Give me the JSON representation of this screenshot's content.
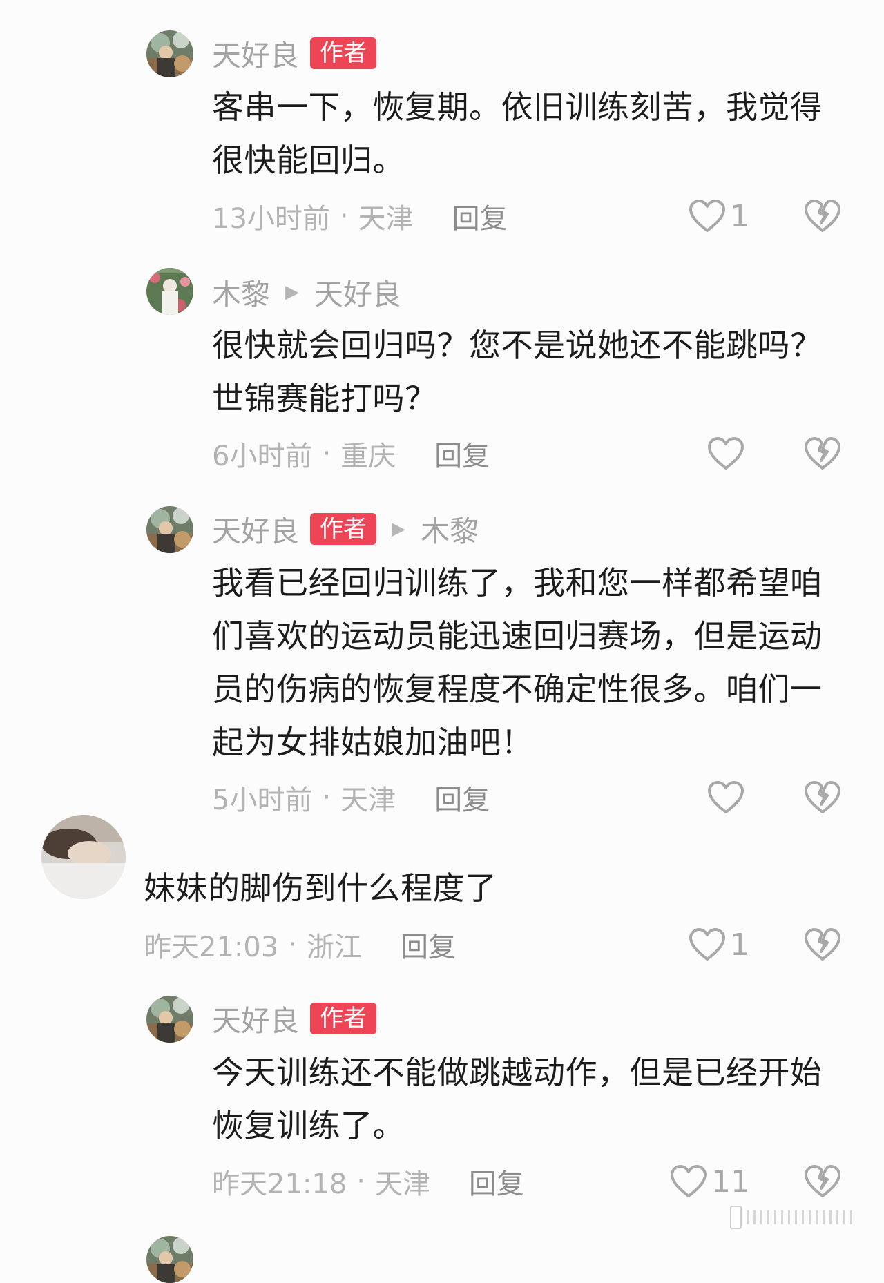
{
  "comments": [
    {
      "user": "天好良",
      "badge": "作者",
      "reply_to": "",
      "text": "客串一下，恢复期。依旧训练刻苦，我觉得很快能回归。",
      "time": "13小时前",
      "location": "天津",
      "reply_label": "回复",
      "likes": "1"
    },
    {
      "user": "木黎",
      "badge": "",
      "reply_to": "天好良",
      "text": "很快就会回归吗？您不是说她还不能跳吗？世锦赛能打吗？",
      "time": "6小时前",
      "location": "重庆",
      "reply_label": "回复",
      "likes": ""
    },
    {
      "user": "天好良",
      "badge": "作者",
      "reply_to": "木黎",
      "text": "我看已经回归训练了，我和您一样都希望咱们喜欢的运动员能迅速回归赛场，但是运动员的伤病的恢复程度不确定性很多。咱们一起为女排姑娘加油吧！",
      "time": "5小时前",
      "location": "天津",
      "reply_label": "回复",
      "likes": ""
    },
    {
      "user": "",
      "badge": "",
      "reply_to": "",
      "text": "妹妹的脚伤到什么程度了",
      "time": "昨天21:03",
      "location": "浙江",
      "reply_label": "回复",
      "likes": "1"
    },
    {
      "user": "天好良",
      "badge": "作者",
      "reply_to": "",
      "text": "今天训练还不能做跳越动作，但是已经开始恢复训练了。",
      "time": "昨天21:18",
      "location": "天津",
      "reply_label": "回复",
      "likes": "11"
    }
  ],
  "icons": {
    "like": "heart-outline-icon",
    "dislike": "broken-heart-icon",
    "reply_arrow": "play-arrow-icon"
  },
  "colors": {
    "badge": "#ee4556",
    "username": "#a3a3a3",
    "body_text": "#1c1c1c",
    "meta_text": "#b3b3b3",
    "icon": "#a8a8a8"
  }
}
